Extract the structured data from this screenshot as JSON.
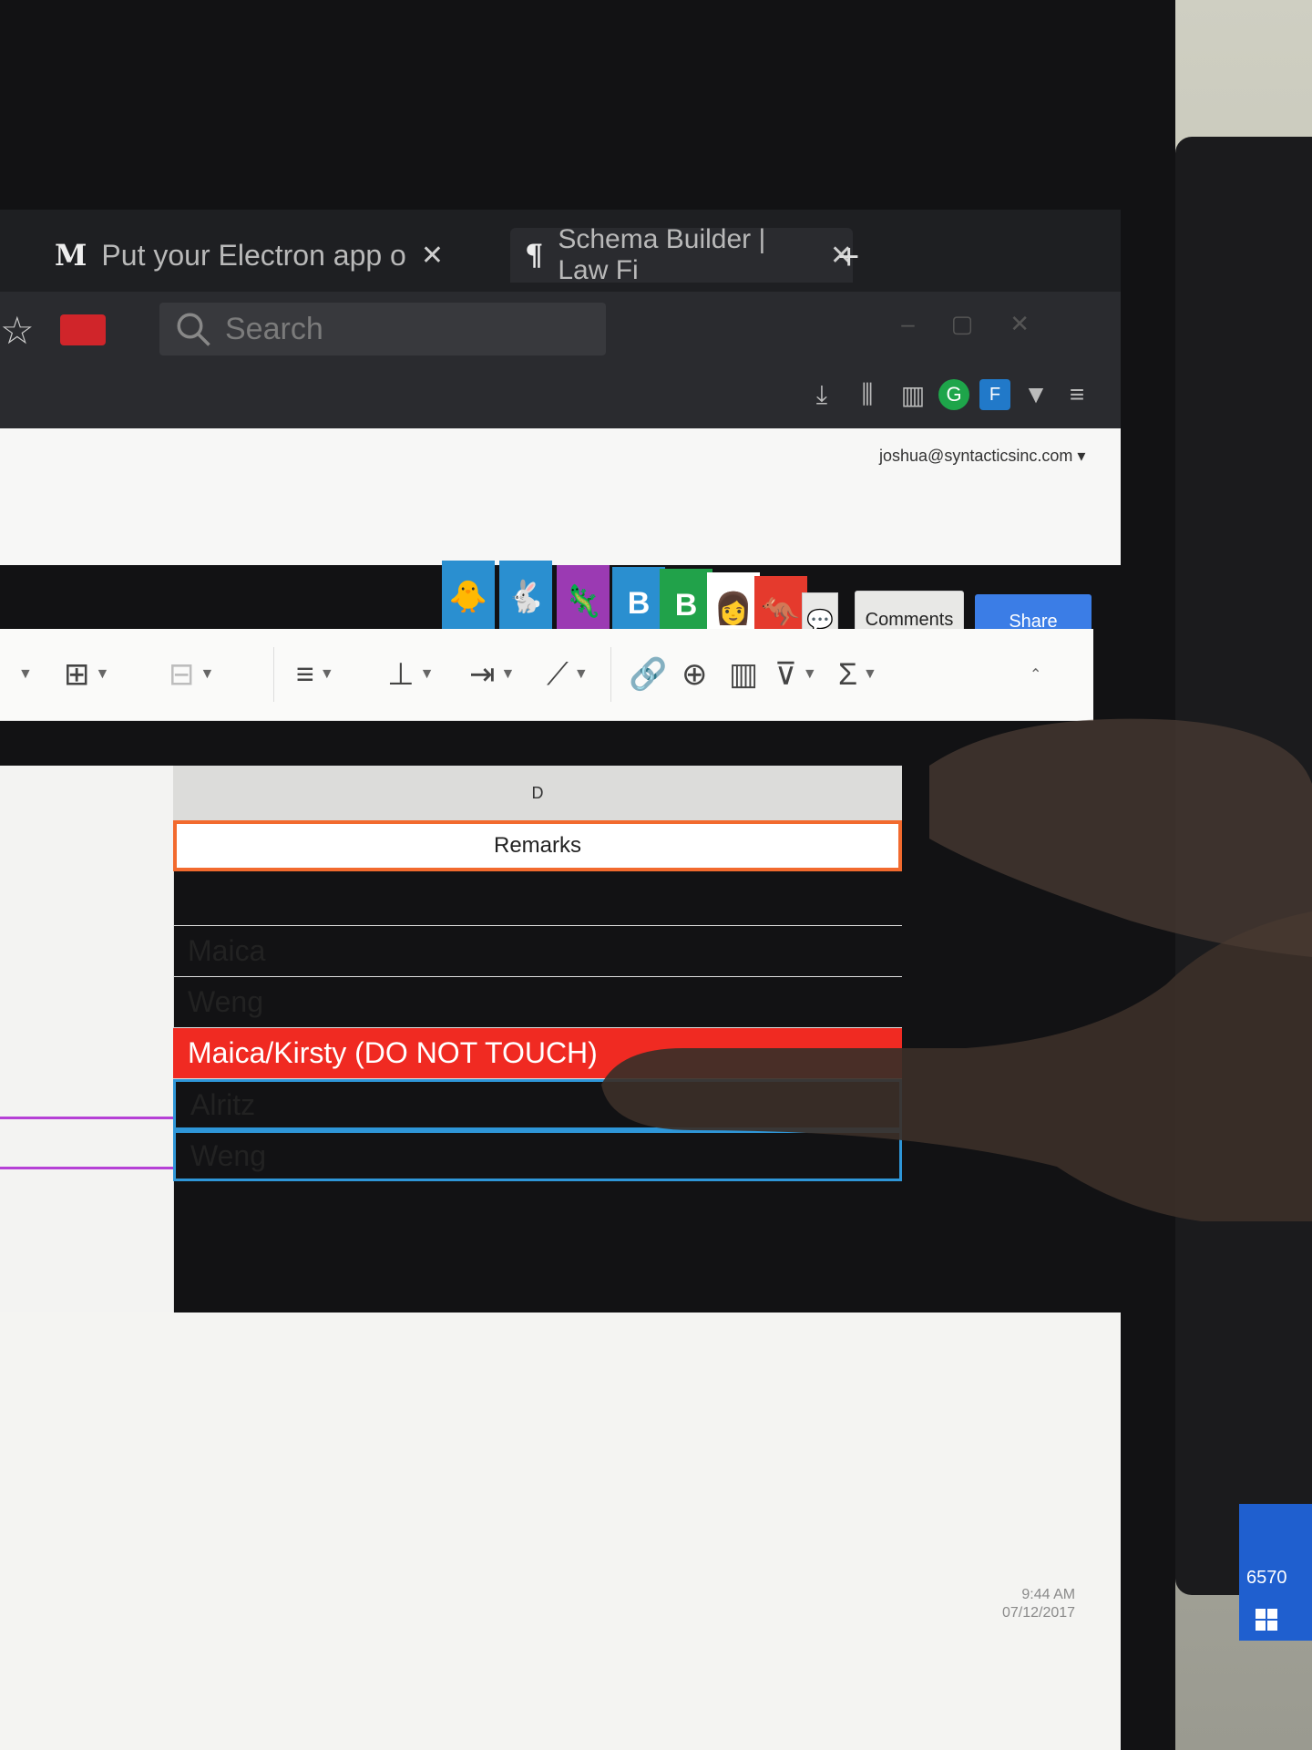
{
  "tabs": [
    {
      "favicon": "M",
      "label": "Put your Electron app o",
      "close": "✕",
      "active": true
    },
    {
      "favicon": "¶",
      "label": "Schema Builder | Law Fi",
      "close": "✕",
      "active": false
    }
  ],
  "new_tab": "+",
  "search": {
    "placeholder": "Search"
  },
  "account": {
    "email": "joshua@syntacticsinc.com ▾"
  },
  "extensions": [
    {
      "label": "",
      "color": "#2a8fd0",
      "glyph": "🐥"
    },
    {
      "label": "",
      "color": "#2a8fd0",
      "glyph": "🐇"
    },
    {
      "label": "",
      "color": "#9b3ab3",
      "glyph": "🦎"
    },
    {
      "label": "B",
      "color": "#2a8fd0",
      "glyph": "B"
    },
    {
      "label": "B",
      "color": "#21a24a",
      "glyph": "B"
    },
    {
      "label": "",
      "color": "#ffffff",
      "glyph": "👩"
    },
    {
      "label": "",
      "color": "#e53a2d",
      "glyph": "🦘"
    }
  ],
  "buttons": {
    "comments": "Comments",
    "share": "Share"
  },
  "sheet": {
    "column_letter": "D",
    "header": "Remarks",
    "rows": [
      {
        "text": "",
        "style": "plain"
      },
      {
        "text": "Maica",
        "style": "plain"
      },
      {
        "text": "Weng",
        "style": "plain"
      },
      {
        "text": "Maica/Kirsty (DO NOT TOUCH)",
        "style": "red"
      },
      {
        "text": "Alritz",
        "style": "blue"
      },
      {
        "text": "Weng",
        "style": "blue"
      }
    ]
  },
  "clock": {
    "time": "9:44 AM",
    "date": "07/12/2017"
  },
  "taskbar_text": "6570",
  "colors": {
    "accent_red": "#f02a22",
    "accent_blue": "#3b7de6",
    "remarks_border": "#f26a2e"
  }
}
